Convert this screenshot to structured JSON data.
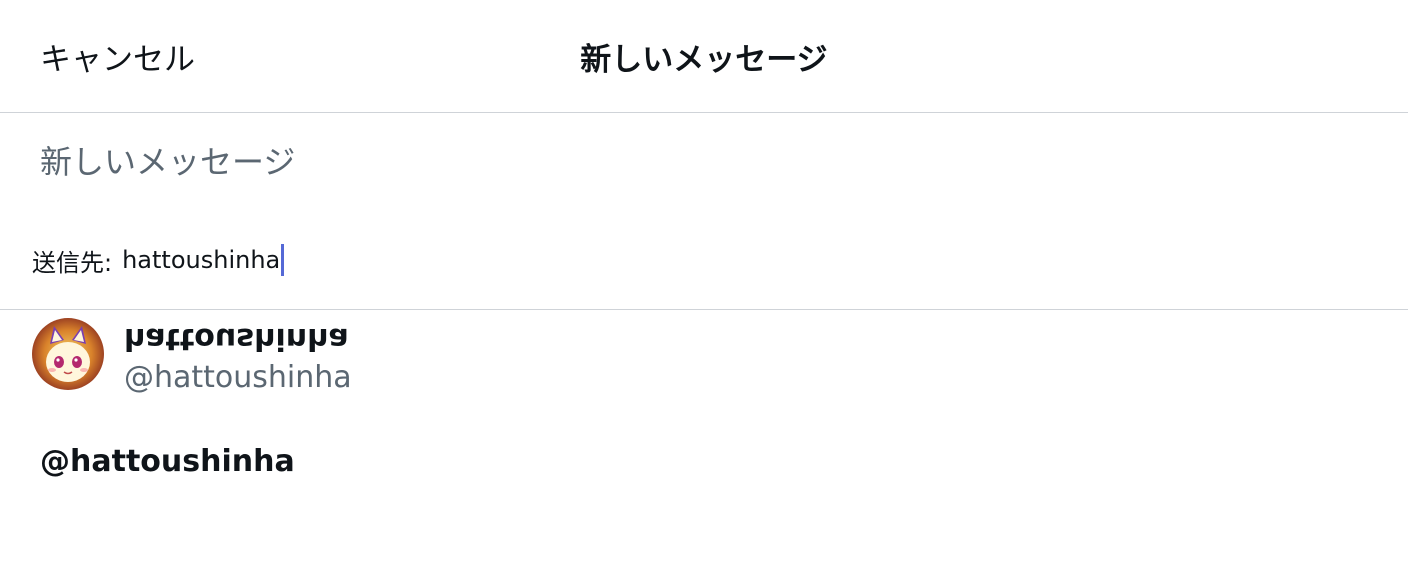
{
  "header": {
    "cancel_label": "キャンセル",
    "title": "新しいメッセージ"
  },
  "group_name": {
    "placeholder": "新しいメッセージ",
    "value": ""
  },
  "recipients": {
    "label": "送信先:",
    "query": "hattoushinha"
  },
  "results": [
    {
      "display_name": "hattoushinha",
      "handle": "@hattoushinha",
      "avatar_icon": "cat-avatar-icon"
    }
  ],
  "suggestion": {
    "text": "@hattoushinha"
  },
  "colors": {
    "caret": "#5569d6",
    "secondary_text": "#5b6772",
    "divider": "#cfd3d8"
  }
}
